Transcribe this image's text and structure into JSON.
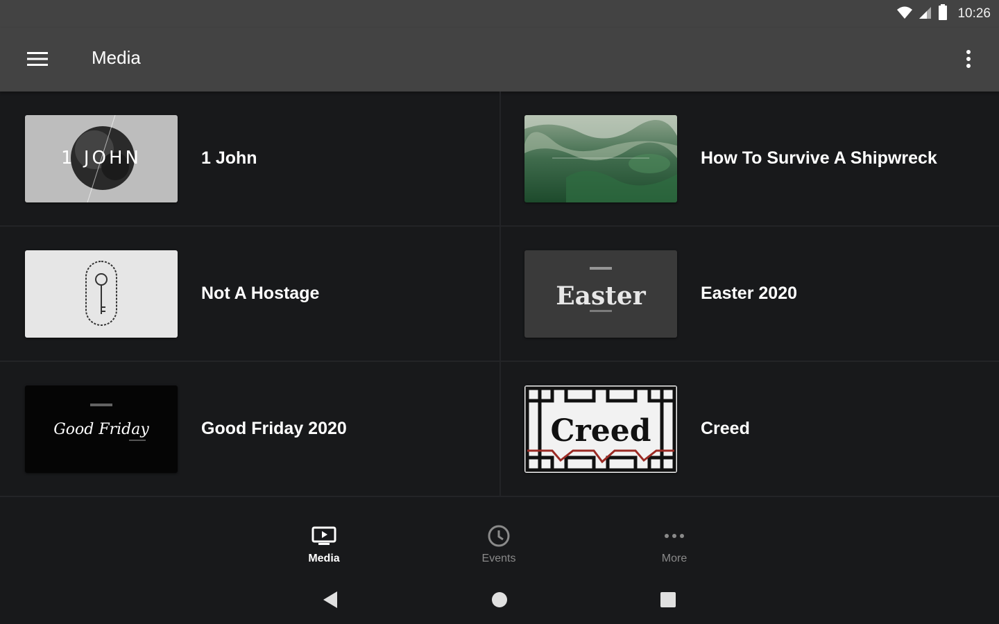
{
  "status_bar": {
    "time": "10:26",
    "icons": [
      "wifi-icon",
      "signal-icon",
      "battery-icon"
    ]
  },
  "app_bar": {
    "title": "Media",
    "menu_icon": "hamburger-menu-icon",
    "overflow_icon": "more-vert-icon",
    "background": "#434343"
  },
  "media_items": [
    {
      "title": "1 John",
      "thumb_text": "1 JOHN"
    },
    {
      "title": "How To Survive A Shipwreck",
      "thumb_text": ""
    },
    {
      "title": "Not A Hostage",
      "thumb_text": ""
    },
    {
      "title": "Easter 2020",
      "thumb_text": "Easter"
    },
    {
      "title": "Good Friday 2020",
      "thumb_text": "Good Friday"
    },
    {
      "title": "Creed",
      "thumb_text": "Creed"
    }
  ],
  "bottom_nav": {
    "items": [
      {
        "label": "Media",
        "icon": "media-tv-icon",
        "active": true
      },
      {
        "label": "Events",
        "icon": "clock-icon",
        "active": false
      },
      {
        "label": "More",
        "icon": "more-horiz-icon",
        "active": false
      }
    ]
  },
  "system_nav": {
    "buttons": [
      "back-icon",
      "home-icon",
      "recents-icon"
    ]
  },
  "colors": {
    "background": "#18191b",
    "bar": "#434343",
    "divider": "#232427",
    "text": "#ffffff",
    "inactive": "#8a8a8a"
  }
}
